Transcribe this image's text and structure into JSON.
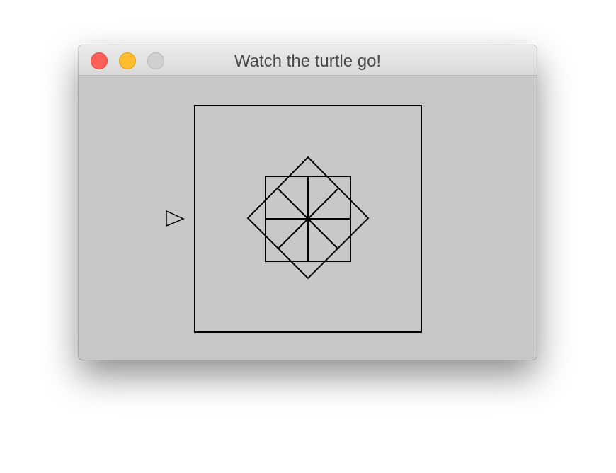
{
  "window": {
    "title": "Watch the turtle go!",
    "buttons": {
      "close_color": "#fe5f57",
      "minimize_color": "#febc2e",
      "zoom_color": "#d0d0d0"
    }
  },
  "canvas": {
    "background_color": "#c8c8c8",
    "stroke_color": "#000000",
    "turtle": {
      "shape": "triangle-arrow",
      "heading": "right"
    }
  },
  "icons": [
    "close-icon",
    "minimize-icon",
    "zoom-icon",
    "turtle-icon"
  ]
}
